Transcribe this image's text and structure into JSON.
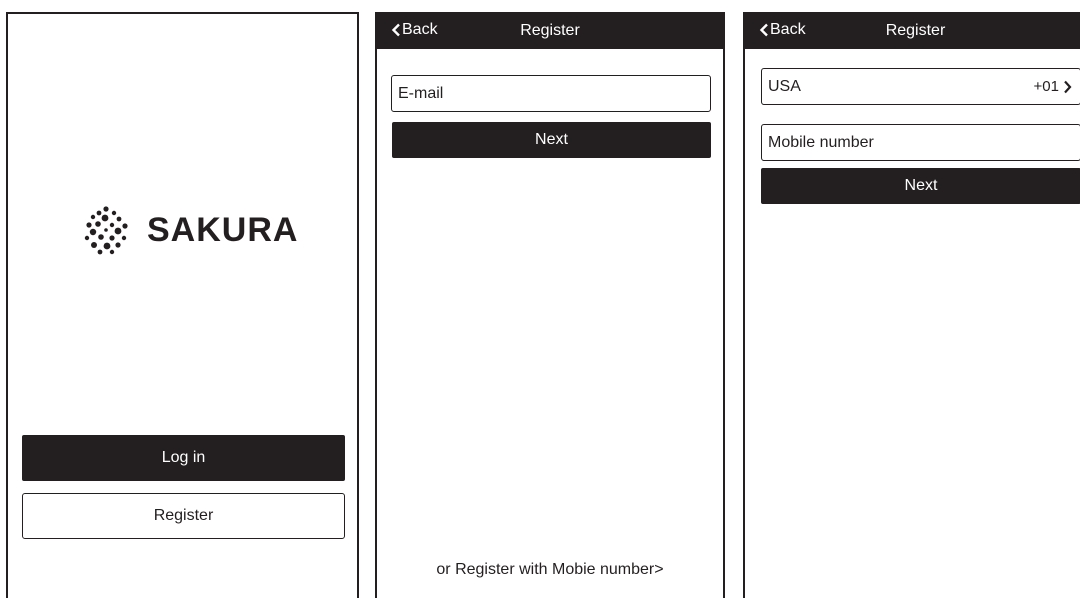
{
  "login_screen": {
    "brand": "SAKURA",
    "login_label": "Log in",
    "register_label": "Register",
    "logo_icon": "dots-burst-icon"
  },
  "email_screen": {
    "back_label": "Back",
    "title": "Register",
    "email_placeholder": "E-mail",
    "next_label": "Next",
    "alt_link": "or Register with Mobie number>"
  },
  "mobile_screen": {
    "back_label": "Back",
    "title": "Register",
    "country": "USA",
    "country_code": "+01",
    "mobile_placeholder": "Mobile number",
    "next_label": "Next"
  },
  "colors": {
    "primary_dark": "#231f20",
    "background": "#ffffff"
  }
}
